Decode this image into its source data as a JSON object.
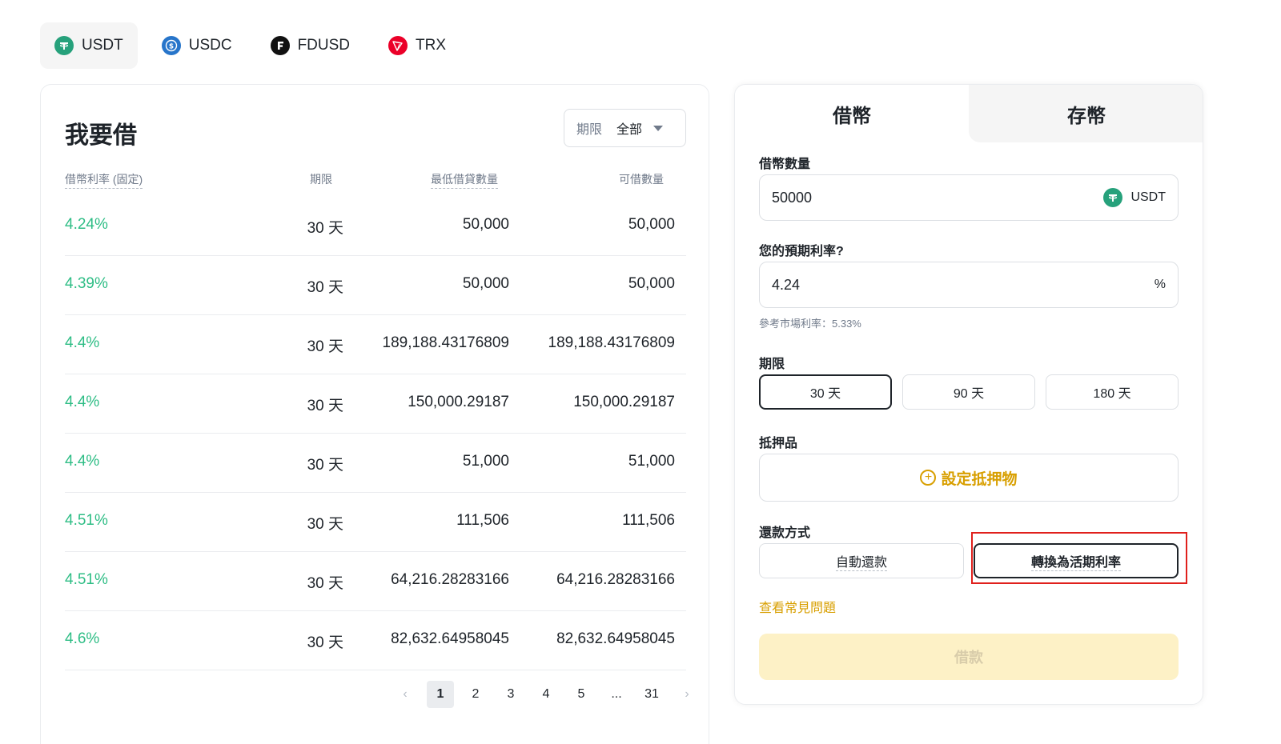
{
  "coin_tabs": [
    {
      "label": "USDT",
      "icon": "usdt-icon",
      "color": "#26a17b"
    },
    {
      "label": "USDC",
      "icon": "usdc-icon",
      "color": "#2775ca"
    },
    {
      "label": "FDUSD",
      "icon": "fdusd-icon",
      "color": "#000000"
    },
    {
      "label": "TRX",
      "icon": "trx-icon",
      "color": "#eb0029"
    }
  ],
  "active_coin": "USDT",
  "left_panel": {
    "title": "我要借",
    "term_filter": {
      "label": "期限",
      "value": "全部"
    },
    "columns": [
      "借幣利率 (固定)",
      "期限",
      "最低借貸數量",
      "可借數量"
    ],
    "rows": [
      {
        "rate": "4.24%",
        "term": "30 天",
        "min": "50,000",
        "available": "50,000"
      },
      {
        "rate": "4.39%",
        "term": "30 天",
        "min": "50,000",
        "available": "50,000"
      },
      {
        "rate": "4.4%",
        "term": "30 天",
        "min": "189,188.43176809",
        "available": "189,188.43176809"
      },
      {
        "rate": "4.4%",
        "term": "30 天",
        "min": "150,000.29187",
        "available": "150,000.29187"
      },
      {
        "rate": "4.4%",
        "term": "30 天",
        "min": "51,000",
        "available": "51,000"
      },
      {
        "rate": "4.51%",
        "term": "30 天",
        "min": "111,506",
        "available": "111,506"
      },
      {
        "rate": "4.51%",
        "term": "30 天",
        "min": "64,216.28283166",
        "available": "64,216.28283166"
      },
      {
        "rate": "4.6%",
        "term": "30 天",
        "min": "82,632.64958045",
        "available": "82,632.64958045"
      }
    ],
    "pagination": {
      "prev": "‹",
      "pages": [
        "1",
        "2",
        "3",
        "4",
        "5",
        "...",
        "31"
      ],
      "current": "1",
      "next": "›"
    }
  },
  "right_panel": {
    "tabs": {
      "borrow": "借幣",
      "deposit": "存幣"
    },
    "amount": {
      "label": "借幣數量",
      "value": "50000",
      "coin": "USDT"
    },
    "rate": {
      "label": "您的預期利率?",
      "value": "4.24",
      "unit": "%"
    },
    "hint": "參考市場利率：5.33%",
    "term": {
      "label": "期限",
      "options": [
        "30 天",
        "90 天",
        "180 天"
      ],
      "selected": "30 天"
    },
    "collateral": {
      "label": "抵押品",
      "button": "設定抵押物"
    },
    "repay": {
      "label": "還款方式",
      "options": [
        "自動還款",
        "轉換為活期利率"
      ],
      "selected": "轉換為活期利率"
    },
    "faq": "查看常見問題",
    "submit": "借款"
  },
  "colors": {
    "accent": "#f0b90b",
    "positive": "#2ebd85",
    "link": "#d89f00",
    "highlight": "#e0201c"
  }
}
